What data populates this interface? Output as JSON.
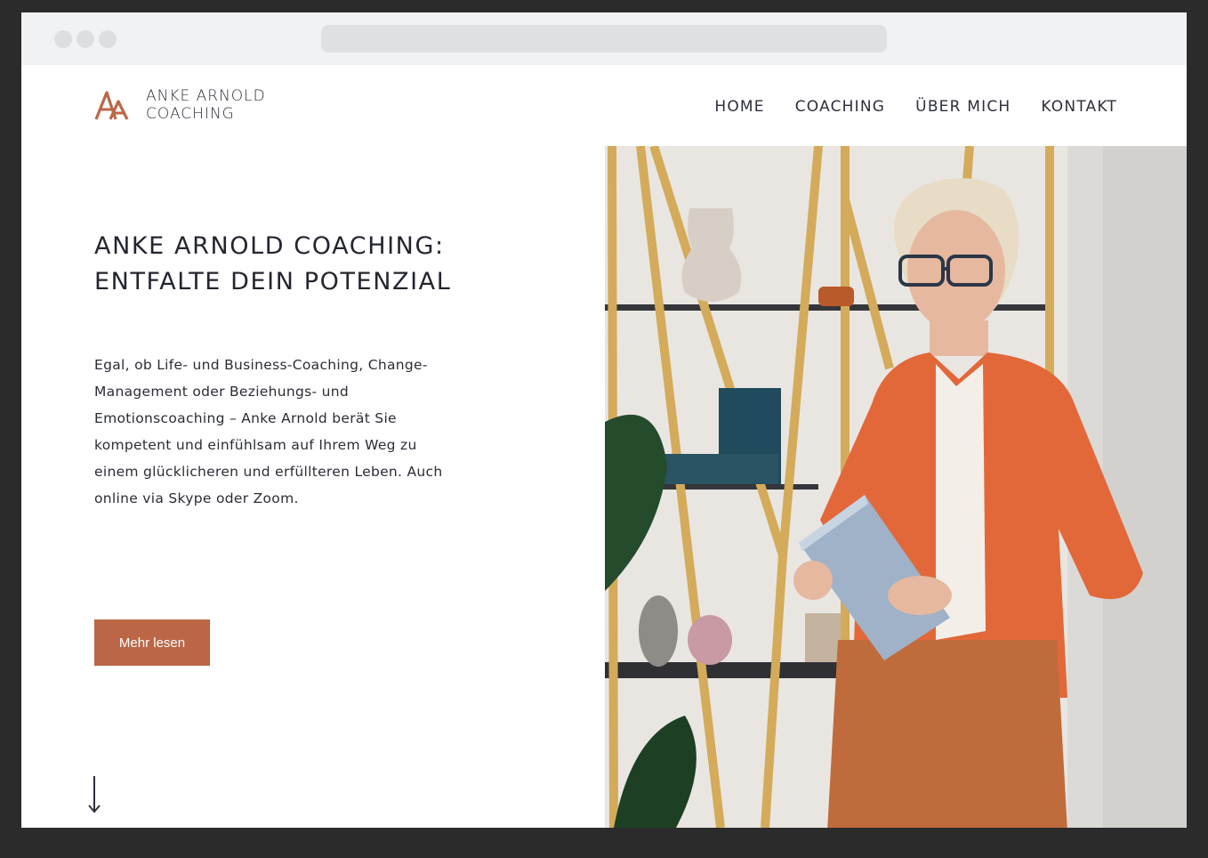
{
  "brand": {
    "line1": "ANKE ARNOLD",
    "line2": "COACHING",
    "logo_icon": "aa-monogram-icon",
    "accent_color": "#bb6747"
  },
  "nav": {
    "items": [
      {
        "label": "HOME"
      },
      {
        "label": "COACHING"
      },
      {
        "label": "ÜBER MICH"
      },
      {
        "label": "KONTAKT"
      }
    ]
  },
  "hero": {
    "title_line1": "ANKE ARNOLD COACHING:",
    "title_line2": "ENTFALTE DEIN POTENZIAL",
    "intro": "Egal, ob Life- und Business-Coaching, Change-Management oder Beziehungs- und Emotionscoaching – Anke Arnold berät Sie kompetent und einfühlsam auf Ihrem Weg zu einem glücklicheren und erfüllteren Leben. Auch online via Skype oder Zoom.",
    "cta_label": "Mehr lesen",
    "scroll_icon": "arrow-down-icon",
    "photo_icon": "portrait-photo-icon"
  }
}
